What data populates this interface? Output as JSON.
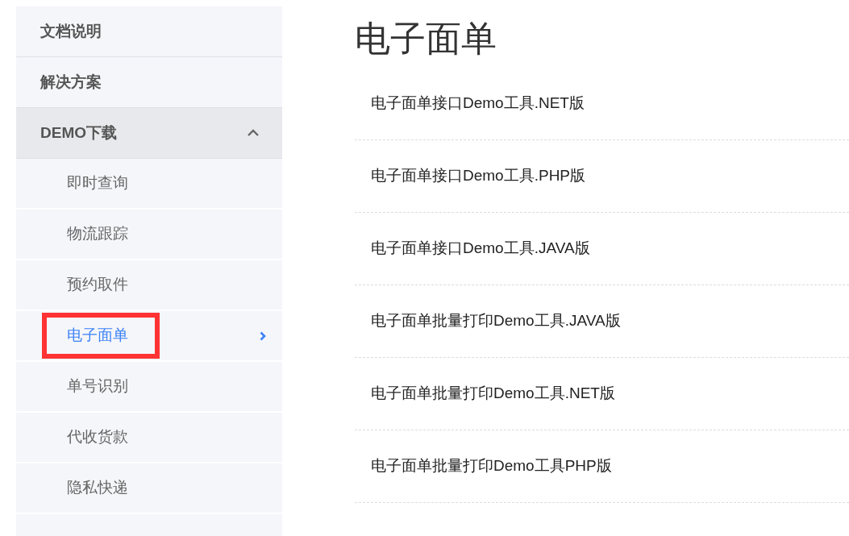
{
  "sidebar": {
    "items": [
      {
        "label": "文档说明",
        "expanded": false
      },
      {
        "label": "解决方案",
        "expanded": false
      },
      {
        "label": "DEMO下载",
        "expanded": true,
        "children": [
          {
            "label": "即时查询",
            "selected": false,
            "highlighted": false
          },
          {
            "label": "物流跟踪",
            "selected": false,
            "highlighted": false
          },
          {
            "label": "预约取件",
            "selected": false,
            "highlighted": false
          },
          {
            "label": "电子面单",
            "selected": true,
            "highlighted": true
          },
          {
            "label": "单号识别",
            "selected": false,
            "highlighted": false
          },
          {
            "label": "代收货款",
            "selected": false,
            "highlighted": false
          },
          {
            "label": "隐私快递",
            "selected": false,
            "highlighted": false
          }
        ]
      }
    ]
  },
  "main": {
    "title": "电子面单",
    "links": [
      "电子面单接口Demo工具.NET版",
      "电子面单接口Demo工具.PHP版",
      "电子面单接口Demo工具.JAVA版",
      "电子面单批量打印Demo工具.JAVA版",
      "电子面单批量打印Demo工具.NET版",
      "电子面单批量打印Demo工具PHP版"
    ]
  }
}
